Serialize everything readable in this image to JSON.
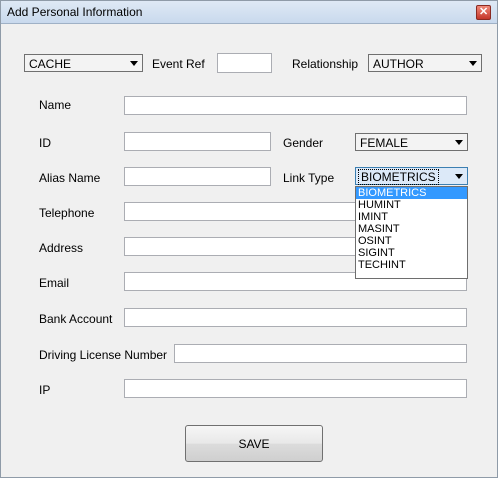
{
  "window": {
    "title": "Add Personal Information",
    "close_glyph": "✕"
  },
  "top_row": {
    "category": {
      "value": "CACHE"
    },
    "event_ref": {
      "label": "Event Ref",
      "value": ""
    },
    "relationship": {
      "label": "Relationship",
      "value": "AUTHOR"
    }
  },
  "fields": {
    "name": {
      "label": "Name",
      "value": ""
    },
    "id": {
      "label": "ID",
      "value": ""
    },
    "gender": {
      "label": "Gender",
      "value": "FEMALE"
    },
    "alias_name": {
      "label": "Alias Name",
      "value": ""
    },
    "link_type": {
      "label": "Link Type",
      "value": "BIOMETRICS"
    },
    "telephone": {
      "label": "Telephone",
      "value": ""
    },
    "address": {
      "label": "Address",
      "value": ""
    },
    "email": {
      "label": "Email",
      "value": ""
    },
    "bank_account": {
      "label": "Bank Account",
      "value": ""
    },
    "driving_license": {
      "label": "Driving License Number",
      "value": ""
    },
    "ip": {
      "label": "IP",
      "value": ""
    }
  },
  "link_type_options": [
    "BIOMETRICS",
    "HUMINT",
    "IMINT",
    "MASINT",
    "OSINT",
    "SIGINT",
    "TECHINT"
  ],
  "save_label": "SAVE",
  "colors": {
    "selection": "#3399ff",
    "title_gradient_top": "#dfe9f5",
    "close_button": "#c4362a"
  }
}
